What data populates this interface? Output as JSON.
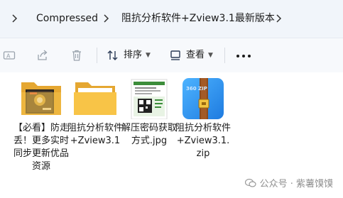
{
  "breadcrumb": {
    "items": [
      "Compressed",
      "阻抗分析软件+Zview3.1最新版本"
    ]
  },
  "toolbar": {
    "sort_label": "排序",
    "view_label": "查看"
  },
  "files": [
    {
      "name": "【必看】防走丢！更多实时同步更新优品资源",
      "type": "folder-with-image"
    },
    {
      "name": "阻抗分析软件+Zview3.1",
      "type": "folder"
    },
    {
      "name": "解压密码获取方式.jpg",
      "type": "image"
    },
    {
      "name": "阻抗分析软件+Zview3.1.zip",
      "type": "zip"
    }
  ],
  "zip_icon_text": "360 ZIP",
  "watermark": {
    "text": "公众号 · 紫薯馍馍"
  }
}
